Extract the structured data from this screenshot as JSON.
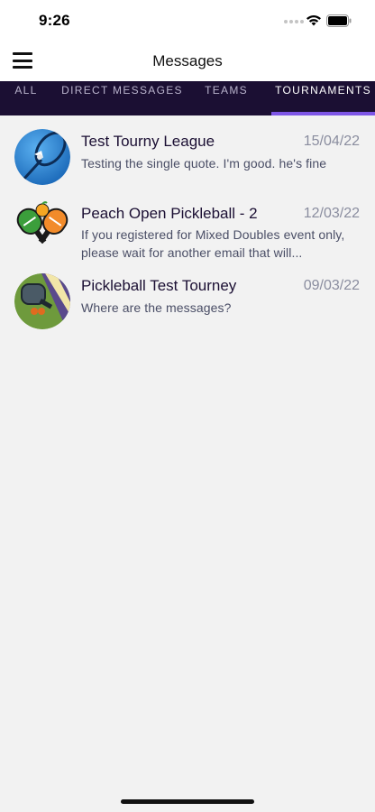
{
  "status": {
    "time": "9:26"
  },
  "nav": {
    "title": "Messages"
  },
  "tabs": [
    {
      "label": "ALL",
      "active": false
    },
    {
      "label": "DIRECT MESSAGES",
      "active": false
    },
    {
      "label": "TEAMS",
      "active": false
    },
    {
      "label": "TOURNAMENTS",
      "active": true
    }
  ],
  "colors": {
    "tab_bar_bg": "#1b0f33",
    "tab_indicator": "#7e56e6",
    "background": "#f2f2f2"
  },
  "messages": [
    {
      "title": "Test Tourny League",
      "date": "15/04/22",
      "preview": "Testing the single quote. I'm good. he's fine",
      "icon": "badminton-racket-shuttlecock-icon"
    },
    {
      "title": "Peach Open Pickleball - 2",
      "date": "12/03/22",
      "preview": "If you registered for Mixed Doubles event only,  please wait for another email that will...",
      "icon": "crossed-paddles-peach-icon"
    },
    {
      "title": "Pickleball Test Tourney",
      "date": "09/03/22",
      "preview": "Where are the messages?",
      "icon": "pickleball-paddle-icon"
    }
  ]
}
